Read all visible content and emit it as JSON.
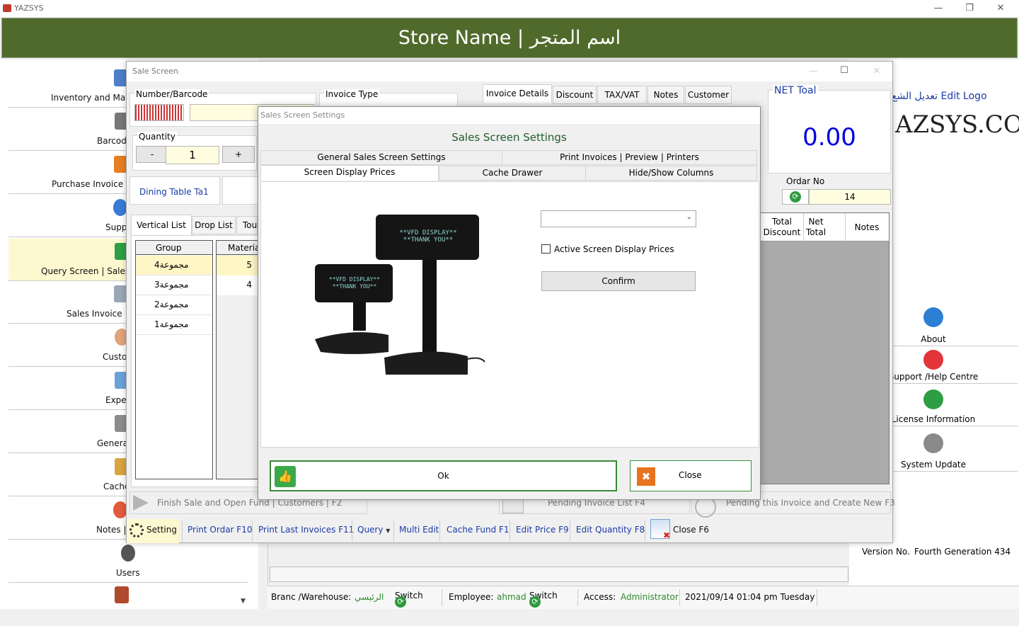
{
  "app": {
    "title": "YAZSYS",
    "banner": "Store Name | اسم المتجر"
  },
  "left_nav": {
    "items": [
      {
        "label": "Inventory and Mate",
        "icon": "inventory-icon"
      },
      {
        "label": "Barcode",
        "icon": "barcode-icon"
      },
      {
        "label": "Purchase Invoice",
        "icon": "purchase-invoice-icon"
      },
      {
        "label": "Supp",
        "icon": "suppliers-icon"
      },
      {
        "label": "Query Screen | Sales",
        "icon": "cart-icon"
      },
      {
        "label": "Sales Invoice |",
        "icon": "sales-invoice-icon"
      },
      {
        "label": "Custo",
        "icon": "customers-icon"
      },
      {
        "label": "Exper",
        "icon": "expenses-icon"
      },
      {
        "label": "Genera",
        "icon": "general-icon"
      },
      {
        "label": "Cache",
        "icon": "cash-icon"
      },
      {
        "label": "Notes |",
        "icon": "clock-icon"
      },
      {
        "label": "Users",
        "icon": "users-icon"
      }
    ]
  },
  "right_panel": {
    "edit_logo": "تعديل الشع Edit Logo",
    "logo_text": "AZSYS.COM",
    "items": [
      "About",
      "Support /Help Centre",
      "License Information",
      "System Update"
    ],
    "version_label": "Version No.",
    "version_value": "Fourth Generation 434"
  },
  "status": {
    "branch_label": "Branc /Warehouse:",
    "branch_value": "الرئيسي",
    "switch1": "Switch",
    "employee_label": "Employee:",
    "employee_value": "ahmad",
    "switch2": "Switch",
    "access_label": "Access:",
    "access_value": "Administrator",
    "datetime": "2021/09/14 01:04 pm Tuesday"
  },
  "sale": {
    "title": "Sale Screen",
    "number_barcode": "Number/Barcode",
    "invoice_type": "Invoice Type",
    "invoice_tabs": [
      "Invoice Details",
      "Discount",
      "TAX/VAT",
      "Notes",
      "Customer"
    ],
    "net_label": "NET Toal",
    "net_value": "0.00",
    "quantity_label": "Quantity",
    "minus": "-",
    "quantity_value": "1",
    "plus": "+",
    "dining": "Dining Table Ta1",
    "order_label": "Ordar No",
    "order_value": "14",
    "list_tabs": [
      "Vertical List",
      "Drop List",
      "Tou"
    ],
    "group_header": "Group",
    "material_header": "Materia",
    "groups": [
      {
        "name": "مجموعة4",
        "count": "5"
      },
      {
        "name": "مجموعة3",
        "count": "4"
      },
      {
        "name": "مجموعة2",
        "count": ""
      },
      {
        "name": "مجموعة1",
        "count": ""
      }
    ],
    "col_total_discount": "Total Discount",
    "col_net_total": "Net Total",
    "col_notes": "Notes",
    "finish": "Finish Sale and Open Fund | Customers | F2",
    "pending_list": "Pending  Invoice List F4",
    "pending_new": "Pending this Invoice and Create New F3",
    "bottom_buttons": [
      "Setting",
      "Print Ordar F10",
      "Print Last Invoices F11",
      "Query",
      "Multi Edit",
      "Cache Fund F1",
      "Edit Price F9",
      "Edit Quantity F8",
      "Close F6"
    ]
  },
  "settings": {
    "title": "Sales Screen Settings",
    "heading": "Sales Screen Settings",
    "tabs_row1": [
      "General Sales Screen Settings",
      "Print Invoices | Preview | Printers"
    ],
    "tabs_row2": [
      "Screen Display Prices",
      "Cache Drawer",
      "Hide/Show Columns"
    ],
    "display_line1": "**VFD DISPLAY**",
    "display_line2": "**THANK YOU**",
    "dropdown_value": "",
    "checkbox_label": "Active Screen Display Prices",
    "confirm": "Confirm",
    "ok": "Ok",
    "close": "Close"
  }
}
